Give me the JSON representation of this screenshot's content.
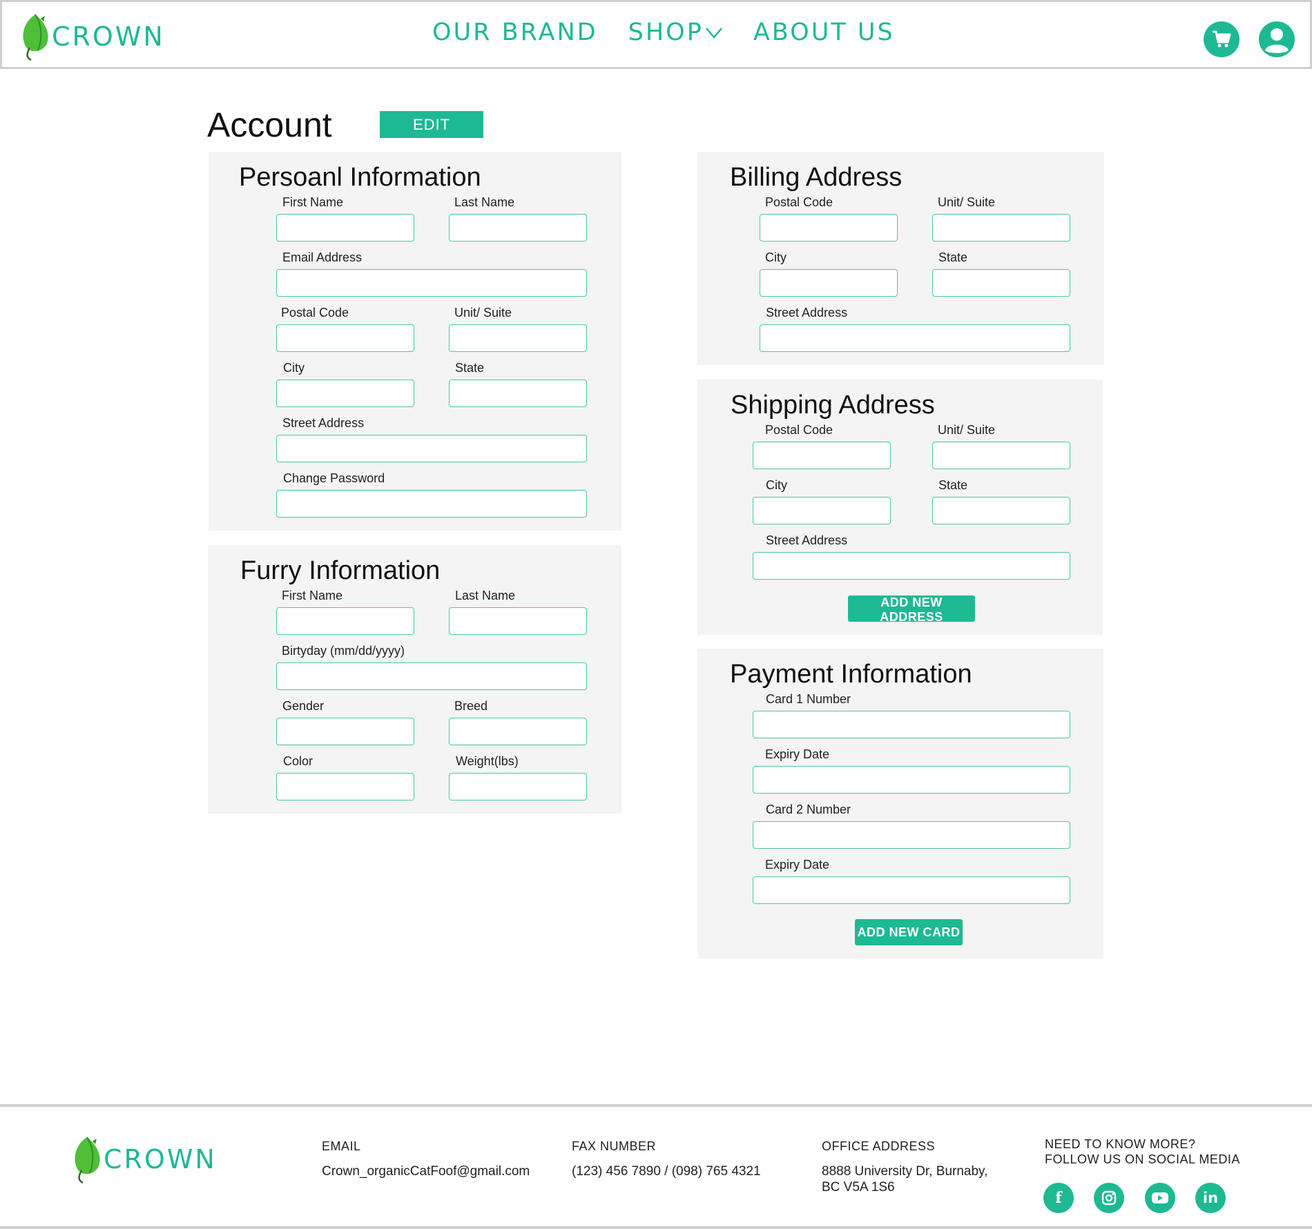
{
  "colors": {
    "accent": "#1db993",
    "panel_bg": "#f4f4f4",
    "field_border": "#4cc7a6"
  },
  "header": {
    "brand": "CROWN",
    "nav": [
      {
        "label": "OUR BRAND"
      },
      {
        "label": "SHOP"
      },
      {
        "label": "ABOUT US"
      }
    ],
    "icons": [
      "cart-icon",
      "user-avatar-icon"
    ]
  },
  "page": {
    "title": "Account",
    "edit_label": "EDIT"
  },
  "personal": {
    "title": "Persoanl Information",
    "first_name": "First Name",
    "last_name": "Last Name",
    "email": "Email Address",
    "postal_code": "Postal Code",
    "unit_suite": "Unit/ Suite",
    "city": "City",
    "state": "State",
    "street": "Street Address",
    "password": "Change Password"
  },
  "furry": {
    "title": "Furry Information",
    "first_name": "First Name",
    "last_name": "Last Name",
    "birthday": "Birtyday (mm/dd/yyyy)",
    "gender": "Gender",
    "breed": "Breed",
    "color": "Color",
    "weight": "Weight(lbs)"
  },
  "billing": {
    "title": "Billing Address",
    "postal_code": "Postal Code",
    "unit_suite": "Unit/ Suite",
    "city": "City",
    "state": "State",
    "street": "Street Address"
  },
  "shipping": {
    "title": "Shipping Address",
    "postal_code": "Postal Code",
    "unit_suite": "Unit/ Suite",
    "city": "City",
    "state": "State",
    "street": "Street Address",
    "add_label": "ADD NEW ADDRESS"
  },
  "payment": {
    "title": "Payment Information",
    "card1": "Card 1 Number",
    "expiry1": "Expiry Date",
    "card2": "Card 2 Number",
    "expiry2": "Expiry Date",
    "add_label": "ADD NEW CARD"
  },
  "footer": {
    "brand": "CROWN",
    "email_heading": "EMAIL",
    "email_value": "Crown_organicCatFoof@gmail.com",
    "fax_heading": "FAX NUMBER",
    "fax_value": "(123) 456 7890 / (098) 765 4321",
    "office_heading": "OFFICE ADDRESS",
    "office_line1": "8888 University Dr, Burnaby,",
    "office_line2": "BC V5A 1S6",
    "social_heading_1": "NEED TO KNOW MORE?",
    "social_heading_2": "FOLLOW US ON SOCIAL MEDIA",
    "social": [
      "facebook-icon",
      "instagram-icon",
      "youtube-icon",
      "linkedin-icon"
    ]
  }
}
